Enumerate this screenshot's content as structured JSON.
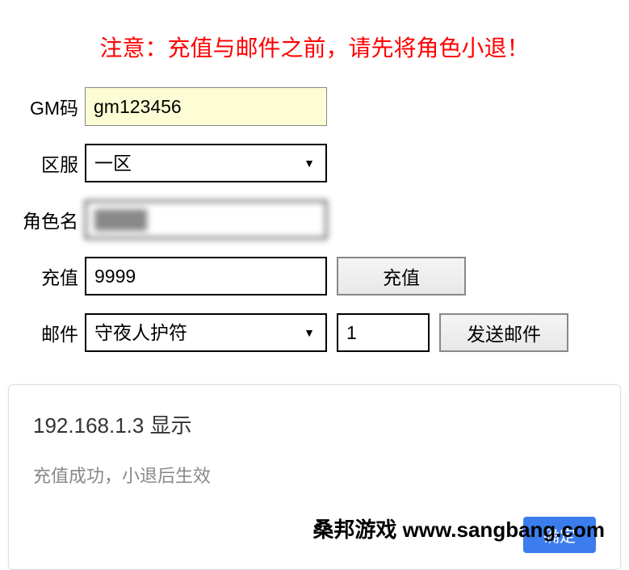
{
  "warning": "注意：充值与邮件之前，请先将角色小退！",
  "form": {
    "gm_code": {
      "label": "GM码",
      "value": "gm123456"
    },
    "server": {
      "label": "区服",
      "value": "一区"
    },
    "role": {
      "label": "角色名",
      "value": "████"
    },
    "recharge": {
      "label": "充值",
      "value": "9999",
      "button": "充值"
    },
    "mail": {
      "label": "邮件",
      "item": "守夜人护符",
      "quantity": "1",
      "button": "发送邮件"
    }
  },
  "dialog": {
    "title": "192.168.1.3 显示",
    "message": "充值成功，小退后生效",
    "confirm": "确定"
  },
  "watermark": "桑邦游戏 www.sangbang.com"
}
